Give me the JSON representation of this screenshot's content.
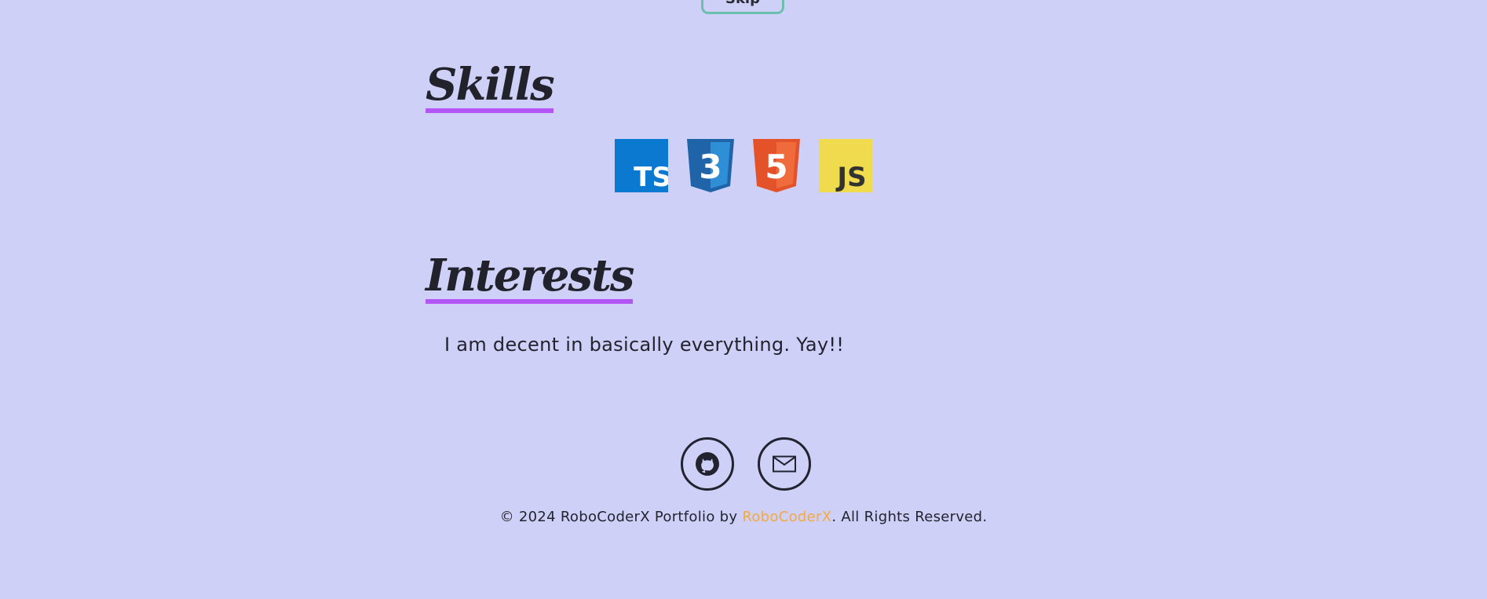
{
  "header": {
    "top_button_label": "Skip"
  },
  "skills": {
    "title": "Skills",
    "icons": [
      {
        "name": "typescript-icon",
        "label": "TS",
        "color": "#0b79cf"
      },
      {
        "name": "css3-icon",
        "label": "3",
        "color": "#2e72b8"
      },
      {
        "name": "html5-icon",
        "label": "5",
        "color": "#e4522a"
      },
      {
        "name": "javascript-icon",
        "label": "JS",
        "color": "#f0db4f"
      }
    ]
  },
  "interests": {
    "title": "Interests",
    "text": "I am decent in basically everything. Yay!!"
  },
  "social": {
    "github_icon": "github-icon",
    "mail_icon": "mail-icon"
  },
  "footer": {
    "prefix": "© 2024 RoboCoderX Portfolio by ",
    "link_text": "RoboCoderX",
    "suffix": ". All Rights Reserved.",
    "link_color": "#f4a93d"
  },
  "colors": {
    "background": "#cfd0f7",
    "accent_underline": "#b257f5",
    "button_border": "#6bbfae"
  }
}
